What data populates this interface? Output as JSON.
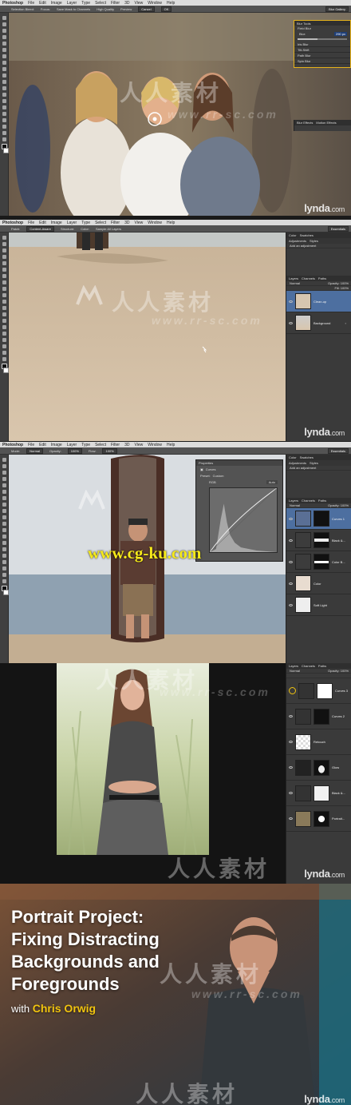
{
  "menu": {
    "app": "Photoshop",
    "items": [
      "File",
      "Edit",
      "Image",
      "Layer",
      "Type",
      "Select",
      "Filter",
      "3D",
      "View",
      "Window",
      "Help"
    ]
  },
  "frame1": {
    "options": [
      "Selection Bleed:",
      "Focus:",
      "Save Mask to Channels",
      "High Quality",
      "Preview",
      "Cancel",
      "OK"
    ],
    "workspace": "Blur Gallery",
    "blur_tools": {
      "title": "Blur Tools",
      "items": [
        "Field Blur",
        "Iris Blur",
        "Tilt-Shift",
        "Path Blur",
        "Spin Blur"
      ],
      "blur_label": "Blur:",
      "blur_value": "290 px"
    },
    "blur_effects": [
      "Blur Effects",
      "Motion Effects"
    ],
    "lynda": "lynda",
    "lynda_com": ".com"
  },
  "frame2": {
    "options": [
      "Patch:",
      "Content-Aware",
      "Structure:",
      "Color:",
      "Sample All Layers"
    ],
    "workspace": "Essentials",
    "panel_tabs": [
      "Color",
      "Swatches"
    ],
    "panel_tabs2": [
      "Adjustments",
      "Styles"
    ],
    "add_adjustment": "Add an adjustment",
    "layers_tabs": [
      "Layers",
      "Channels",
      "Paths"
    ],
    "blend": "Normal",
    "opacity": "Opacity: 100%",
    "fill": "Fill: 100%",
    "layers": [
      "Clean-up",
      "Background"
    ],
    "lynda": "lynda",
    "lynda_com": ".com"
  },
  "frame3": {
    "options": [
      "Mode:",
      "Normal",
      "Opacity:",
      "100%",
      "Flow:",
      "100%"
    ],
    "workspace": "Essentials",
    "properties": {
      "title": "Properties",
      "mode": "Curves",
      "preset": "Preset:",
      "preset_value": "Custom",
      "channel": "RGB",
      "auto": "Auto"
    },
    "panel_tabs": [
      "Color",
      "Swatches"
    ],
    "panel_tabs2": [
      "Adjustments",
      "Styles"
    ],
    "add_adjustment": "Add an adjustment",
    "layers_tabs": [
      "Layers",
      "Channels",
      "Paths"
    ],
    "blend": "Normal",
    "opacity": "Opacity: 100%",
    "layers": [
      "Curves 1",
      "Black &...",
      "Color B...",
      "Color",
      "Soft Light"
    ],
    "watermark_cg": "www.cg-ku.com"
  },
  "frame4": {
    "layers_tabs": [
      "Layers",
      "Channels",
      "Paths"
    ],
    "blend": "Normal",
    "opacity": "Opacity: 100%",
    "layers": [
      "Curves 3",
      "Curves 2",
      "Retouch",
      "Glow",
      "Black &...",
      "Portrait..."
    ],
    "lynda": "lynda",
    "lynda_com": ".com"
  },
  "frame5": {
    "title_lines": [
      "Portrait Project:",
      "Fixing Distracting",
      "Backgrounds and",
      "Foregrounds"
    ],
    "with": "with",
    "author": "Chris Orwig",
    "lynda": "lynda",
    "lynda_com": ".com"
  },
  "watermarks": {
    "cn": "人人素材",
    "url": "www.rr-sc.com"
  }
}
